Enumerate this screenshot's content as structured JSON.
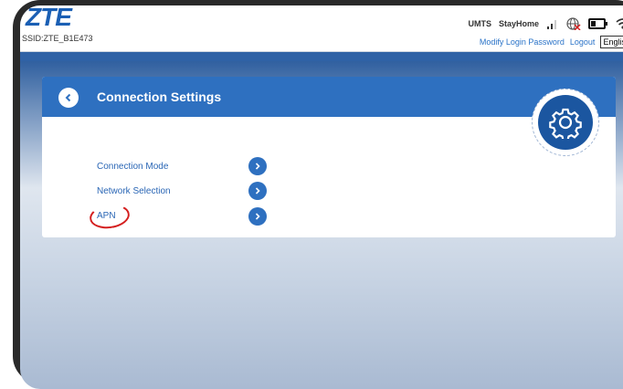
{
  "header": {
    "logo": "ZTE",
    "ssid": "SSID:ZTE_B1E473",
    "network_type": "UMTS",
    "operator": "StayHome",
    "links": {
      "modify_password": "Modify Login Password",
      "logout": "Logout"
    },
    "language": "English"
  },
  "card": {
    "title": "Connection Settings",
    "items": [
      {
        "label": "Connection Mode"
      },
      {
        "label": "Network Selection"
      },
      {
        "label": "APN"
      }
    ]
  },
  "icons": {
    "signal": "signal-icon",
    "globe": "globe-disconnected-icon",
    "battery": "battery-icon",
    "wifi": "wifi-icon",
    "back": "chevron-left-icon",
    "gear": "gear-icon",
    "arrow": "chevron-right-icon"
  },
  "colors": {
    "brand": "#1a5fb4",
    "header": "#2e70c0",
    "link": "#2a73c8",
    "annotation": "#d41f1f"
  }
}
